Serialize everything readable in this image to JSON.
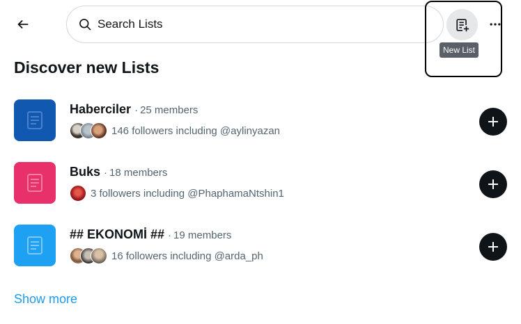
{
  "search": {
    "placeholder": "Search Lists"
  },
  "header": {
    "new_list_tooltip": "New List",
    "accent": "#1d9bf0"
  },
  "discover": {
    "title": "Discover new Lists",
    "lists": [
      {
        "name": "Haberciler",
        "separator": "·",
        "members": "25 members",
        "followers": "146 followers including @aylinyazan",
        "thumb_color": "#1158b0",
        "thumb_icon": "list-document-icon"
      },
      {
        "name": "Buks",
        "separator": "·",
        "members": "18 members",
        "followers": "3 followers including @PhaphamaNtshin1",
        "thumb_color": "#e8306a",
        "thumb_icon": "list-document-icon"
      },
      {
        "name": "## EKONOMİ ##",
        "separator": "·",
        "members": "19 members",
        "followers": "16 followers including @arda_ph",
        "thumb_color": "#1ea1f2",
        "thumb_icon": "list-document-icon"
      }
    ],
    "show_more": "Show more"
  }
}
